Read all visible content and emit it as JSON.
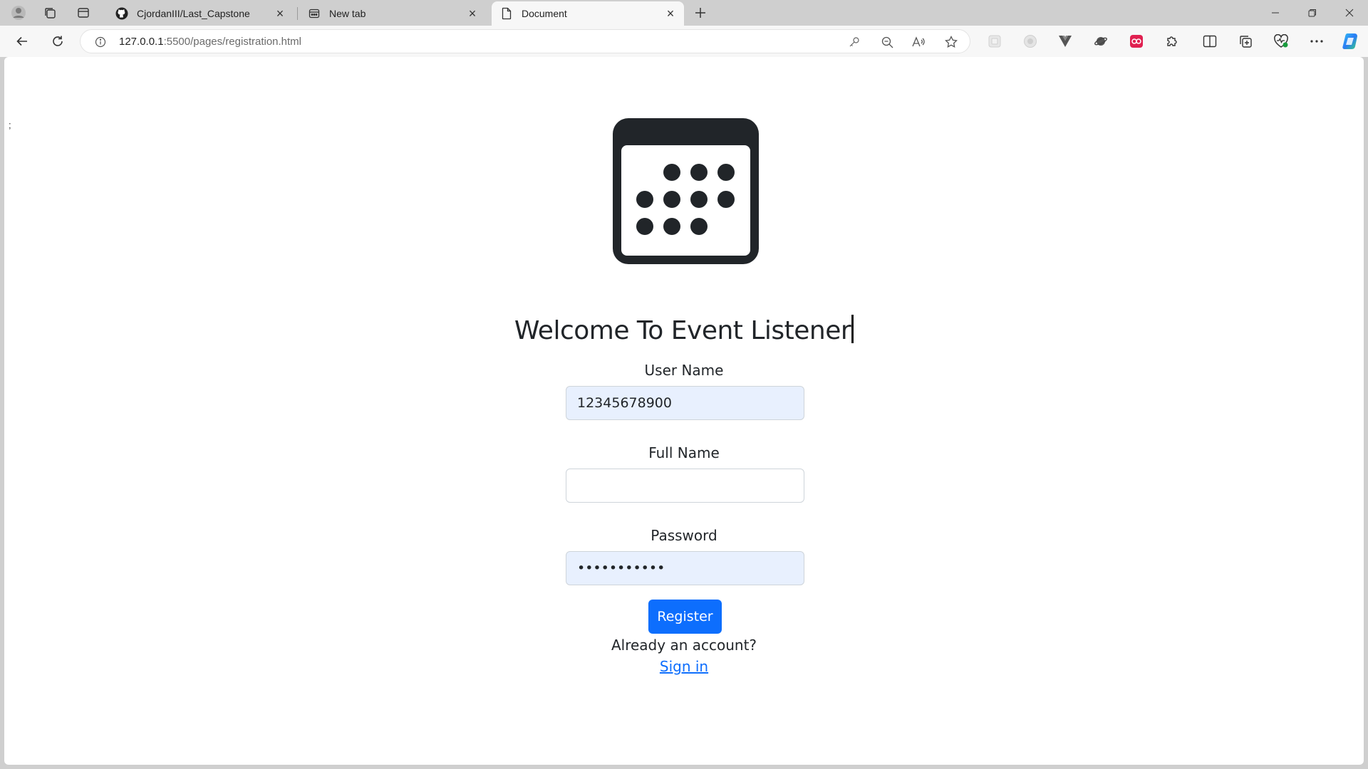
{
  "tabs": [
    {
      "title": "CjordanIII/Last_Capstone",
      "favicon": "github-icon"
    },
    {
      "title": "New tab",
      "favicon": "newtab-icon"
    },
    {
      "title": "Document",
      "favicon": "document-icon",
      "active": true
    }
  ],
  "address": {
    "host": "127.0.0.1",
    "rest": ":5500/pages/registration.html"
  },
  "stray_text": ";",
  "page": {
    "title": "Welcome To Event Listener",
    "username_label": "User Name",
    "username_value": "12345678900",
    "fullname_label": "Full Name",
    "fullname_value": "",
    "password_label": "Password",
    "password_value": "12345678901",
    "register_label": "Register",
    "already_text": "Already an account?",
    "signin_label": "Sign in"
  },
  "colors": {
    "primary": "#0d6efd",
    "autofill_bg": "#e8f0fe",
    "text": "#212529"
  }
}
